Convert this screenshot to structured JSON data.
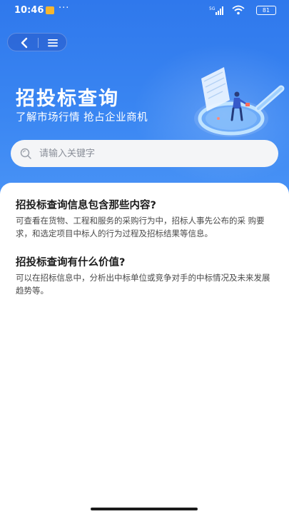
{
  "status_bar": {
    "time": "10:46",
    "dots": "···",
    "network": "5G",
    "battery": "81"
  },
  "nav": {
    "back_icon": "chevron-left-icon",
    "menu_icon": "menu-icon"
  },
  "hero": {
    "title": "招投标查询",
    "subtitle": "了解市场行情 抢占企业商机",
    "background_color": "#3a86f2"
  },
  "search": {
    "placeholder": "请输入关键字",
    "value": ""
  },
  "faq": [
    {
      "question": "招投标查询信息包含那些内容?",
      "answer": "可查看在货物、工程和服务的采购行为中，招标人事先公布的采 购要求，和选定项目中标人的行为过程及招标结果等信息。"
    },
    {
      "question": "招投标查询有什么价值?",
      "answer": "可以在招标信息中，分析出中标单位或竞争对手的中标情况及未来发展趋势等。"
    }
  ]
}
